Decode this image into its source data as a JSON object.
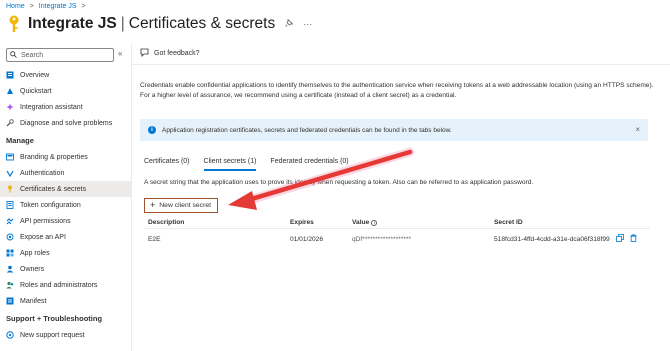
{
  "breadcrumb": {
    "home": "Home",
    "separator": ">",
    "app": "Integrate JS",
    "trailing": ">"
  },
  "header": {
    "app_name": "Integrate JS",
    "divider": "|",
    "section": "Certificates & secrets",
    "pin_icon": "pin-icon",
    "more_icon": "more-icon",
    "more_label": "···"
  },
  "sidebar": {
    "search_placeholder": "Search",
    "collapse_label": "«",
    "items": [
      {
        "label": "Overview",
        "icon": "overview-icon",
        "color": "#0078d4"
      },
      {
        "label": "Quickstart",
        "icon": "quickstart-icon",
        "color": "#0078d4"
      },
      {
        "label": "Integration assistant",
        "icon": "assistant-icon",
        "color": "#a855f7"
      },
      {
        "label": "Diagnose and solve problems",
        "icon": "wrench-icon",
        "color": "#605e5c"
      }
    ],
    "manage_header": "Manage",
    "manage_items": [
      {
        "label": "Branding & properties",
        "icon": "branding-icon",
        "color": "#0078d4"
      },
      {
        "label": "Authentication",
        "icon": "authentication-icon",
        "color": "#0078d4"
      },
      {
        "label": "Certificates & secrets",
        "icon": "key-icon",
        "color": "#f2b60a"
      },
      {
        "label": "Token configuration",
        "icon": "token-icon",
        "color": "#0078d4"
      },
      {
        "label": "API permissions",
        "icon": "api-permissions-icon",
        "color": "#0078d4"
      },
      {
        "label": "Expose an API",
        "icon": "expose-api-icon",
        "color": "#0078d4"
      },
      {
        "label": "App roles",
        "icon": "app-roles-icon",
        "color": "#0078d4"
      },
      {
        "label": "Owners",
        "icon": "owners-icon",
        "color": "#0078d4"
      },
      {
        "label": "Roles and administrators",
        "icon": "roles-icon",
        "color": "#2e8b57"
      },
      {
        "label": "Manifest",
        "icon": "manifest-icon",
        "color": "#0078d4"
      }
    ],
    "support_header": "Support + Troubleshooting",
    "support_items": [
      {
        "label": "New support request",
        "icon": "support-icon",
        "color": "#0078d4"
      }
    ]
  },
  "toolbar": {
    "feedback_label": "Got feedback?"
  },
  "description": "Credentials enable confidential applications to identify themselves to the authentication service when receiving tokens at a web addressable location (using an HTTPS scheme). For a higher level of assurance, we recommend using a certificate (instead of a client secret) as a credential.",
  "info_bar": {
    "text": "Application registration certificates, secrets and federated credentials can be found in the tabs below.",
    "close_label": "×"
  },
  "tabs": [
    {
      "label": "Certificates (0)"
    },
    {
      "label": "Client secrets (1)"
    },
    {
      "label": "Federated credentials (0)"
    }
  ],
  "secret_description": "A secret string that the application uses to prove its identity when requesting a token. Also can be referred to as application password.",
  "new_secret_label": "New client secret",
  "table": {
    "headers": {
      "description": "Description",
      "expires": "Expires",
      "value": "Value",
      "secret_id": "Secret ID"
    },
    "rows": [
      {
        "description": "E2E",
        "expires": "01/01/2026",
        "value": "qDf*******************",
        "secret_id": "518fcd31-4ffd-4cdd-a31e-dca06f318f99"
      }
    ]
  },
  "colors": {
    "accent": "#0078d4",
    "highlight_border": "#a0522d",
    "arrow": "#e53935",
    "info_bg": "#e6f2fb"
  }
}
